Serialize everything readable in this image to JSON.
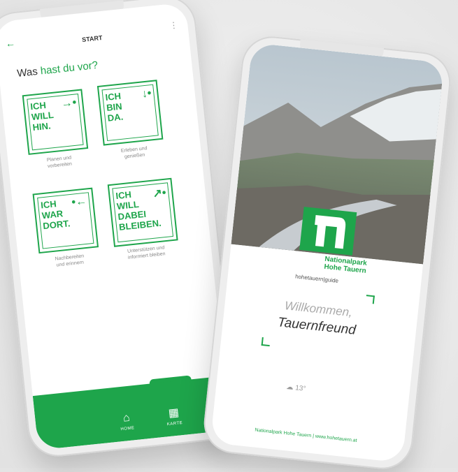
{
  "left_screen": {
    "header_title": "START",
    "question_prefix": "Was",
    "question_highlight": "hast du vor?",
    "tiles": [
      {
        "text": "ICH\nWILL\nHIN.",
        "symbol": "→•",
        "caption": "Planen und\nvorbereiten"
      },
      {
        "text": "ICH\nBIN\nDA.",
        "symbol": "↓•",
        "caption": "Erleben und\ngenießen"
      },
      {
        "text": "ICH\nWAR\nDORT.",
        "symbol": "•←",
        "caption": "Nachbereiten\nund erinnern"
      },
      {
        "text": "ICH\nWILL\nDABEI\nBLEIBEN.",
        "symbol": "↗•",
        "caption": "Unterstützen und\ninformiert bleiben"
      }
    ],
    "nav": [
      {
        "label": "HOME",
        "icon": "home-icon"
      },
      {
        "label": "KARTE",
        "icon": "map-icon"
      }
    ],
    "colors": {
      "accent": "#1ea54b"
    }
  },
  "right_screen": {
    "logo_line1": "Nationalpark",
    "logo_line2": "Hohe Tauern",
    "brand_small": "hohetauern|guide",
    "welcome_line1": "Willkommen,",
    "welcome_line2": "Tauernfreund",
    "weather_value": "13°",
    "footer": "Nationalpark Hohe Tauern | www.hohetauern.at"
  }
}
